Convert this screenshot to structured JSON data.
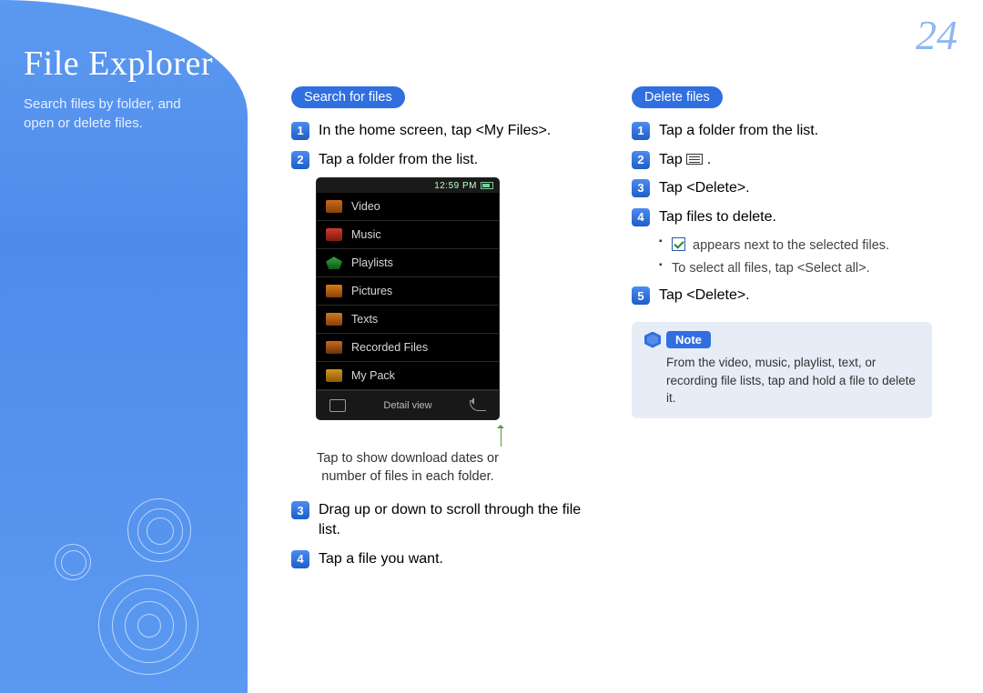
{
  "page_number": "24",
  "sidebar": {
    "title": "File Explorer",
    "subtitle": "Search files by folder, and open or delete files."
  },
  "search_section": {
    "heading": "Search for files",
    "step1_a": "In the ",
    "step1_b": "home screen",
    "step1_c": ", tap <My Files>.",
    "step2": "Tap a folder from the list.",
    "step3": "Drag up or down to scroll through the file list.",
    "step4": "Tap a file you want.",
    "caption": "Tap to show download dates or number of files in each folder."
  },
  "phone": {
    "status_time": "12:59 PM",
    "folders": [
      "Video",
      "Music",
      "Playlists",
      "Pictures",
      "Texts",
      "Recorded Files",
      "My Pack"
    ],
    "bar_center": "Detail view"
  },
  "delete_section": {
    "heading": "Delete files",
    "step1": "Tap a folder from the list.",
    "step2_a": "Tap ",
    "step2_b": " .",
    "step3": "Tap <Delete>.",
    "step4": "Tap files to delete.",
    "bullet1": " appears next to the selected files.",
    "bullet2": "To select all files, tap <Select all>.",
    "step5": "Tap <Delete>."
  },
  "note": {
    "label": "Note",
    "text": "From the video, music, playlist, text, or recording file lists, tap and hold a file to delete it."
  }
}
